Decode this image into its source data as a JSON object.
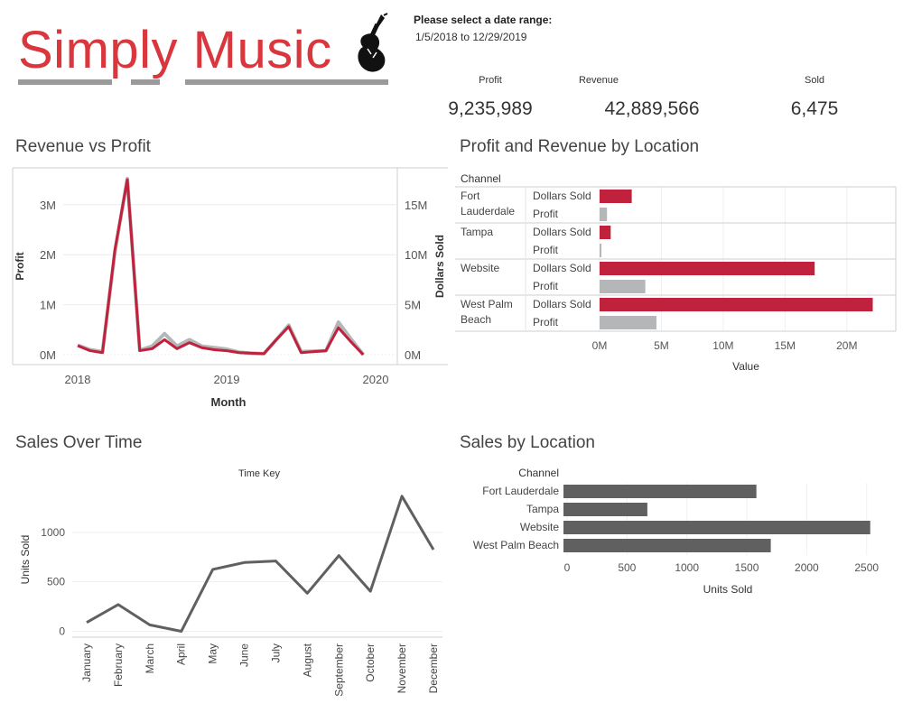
{
  "header": {
    "logo_text": "Simply Music",
    "date_range_label": "Please select a date range:",
    "date_range_value": "1/5/2018 to 12/29/2019"
  },
  "kpis": [
    {
      "label": "Profit",
      "value": "9,235,989"
    },
    {
      "label": "Revenue",
      "value": "42,889,566"
    },
    {
      "label": "Sold",
      "value": "6,475"
    }
  ],
  "colors": {
    "accent": "#c0213d",
    "profit_gray": "#b4b6b8",
    "dark_gray": "#606060",
    "logo_red": "#d9363e"
  },
  "panels": {
    "revenue_vs_profit": "Revenue vs Profit",
    "profit_revenue_location": "Profit and Revenue by Location",
    "sales_over_time": "Sales Over Time",
    "sales_by_location": "Sales by Location"
  },
  "chart_data": [
    {
      "type": "line",
      "title": "Revenue vs Profit",
      "xlabel": "Month",
      "ylabel": "Profit",
      "y2label": "Dollars Sold",
      "x_ticks": [
        "2018",
        "2019",
        "2020"
      ],
      "y_ticks": [
        "3M",
        "2M",
        "1M",
        "0M"
      ],
      "y2_ticks": [
        "15M",
        "10M",
        "5M",
        "0M"
      ],
      "ylim": [
        0,
        3700000
      ],
      "y2lim": [
        0,
        18500000
      ],
      "x": [
        "2018-01",
        "2018-02",
        "2018-03",
        "2018-04",
        "2018-05",
        "2018-06",
        "2018-07",
        "2018-08",
        "2018-09",
        "2018-10",
        "2018-11",
        "2018-12",
        "2019-01",
        "2019-02",
        "2019-03",
        "2019-04",
        "2019-05",
        "2019-06",
        "2019-07",
        "2019-08",
        "2019-09",
        "2019-10",
        "2019-11",
        "2019-12"
      ],
      "series": [
        {
          "name": "Profit",
          "color": "#b4b6b8",
          "axis": "left",
          "values": [
            190000,
            100000,
            60000,
            2050000,
            3520000,
            90000,
            170000,
            420000,
            170000,
            300000,
            170000,
            140000,
            110000,
            50000,
            30000,
            20000,
            300000,
            590000,
            60000,
            70000,
            80000,
            650000,
            320000,
            0
          ]
        },
        {
          "name": "Dollars Sold",
          "color": "#c0213d",
          "axis": "right",
          "values": [
            900000,
            400000,
            200000,
            10500000,
            17500000,
            400000,
            600000,
            1500000,
            600000,
            1200000,
            700000,
            500000,
            400000,
            200000,
            150000,
            100000,
            1500000,
            2800000,
            200000,
            300000,
            400000,
            2700000,
            1300000,
            0
          ]
        }
      ]
    },
    {
      "type": "bar",
      "title": "Profit and Revenue by Location",
      "row_header": "Channel",
      "xlabel": "Value",
      "x_ticks": [
        "0M",
        "5M",
        "10M",
        "15M",
        "20M"
      ],
      "xlim": [
        0,
        22500000
      ],
      "categories": [
        "Fort Lauderdale",
        "Tampa",
        "Website",
        "West Palm Beach"
      ],
      "category_labels": [
        [
          "Fort",
          "Lauderdale"
        ],
        [
          "Tampa"
        ],
        [
          "Website"
        ],
        [
          "West Palm",
          "Beach"
        ]
      ],
      "series": [
        {
          "name": "Dollars Sold",
          "color": "#c0213d",
          "values": [
            2600000,
            900000,
            17400000,
            22100000
          ]
        },
        {
          "name": "Profit",
          "color": "#b4b6b8",
          "values": [
            600000,
            150000,
            3700000,
            4600000
          ]
        }
      ]
    },
    {
      "type": "line",
      "title": "Sales Over Time",
      "subtitle": "Time Key",
      "ylabel": "Units Sold",
      "y_ticks": [
        "1000",
        "500",
        "0"
      ],
      "ylim": [
        -50,
        1500
      ],
      "categories": [
        "January",
        "February",
        "March",
        "April",
        "May",
        "June",
        "July",
        "August",
        "September",
        "October",
        "November",
        "December"
      ],
      "values": [
        90,
        270,
        65,
        0,
        625,
        695,
        710,
        385,
        765,
        405,
        1365,
        825
      ],
      "color": "#606060"
    },
    {
      "type": "bar",
      "title": "Sales by Location",
      "row_header": "Channel",
      "xlabel": "Units Sold",
      "x_ticks": [
        "0",
        "500",
        "1000",
        "1500",
        "2000",
        "2500"
      ],
      "xlim": [
        0,
        2600
      ],
      "categories": [
        "Fort Lauderdale",
        "Tampa",
        "Website",
        "West Palm Beach"
      ],
      "values": [
        1580,
        670,
        2530,
        1700
      ],
      "color": "#606060"
    }
  ]
}
